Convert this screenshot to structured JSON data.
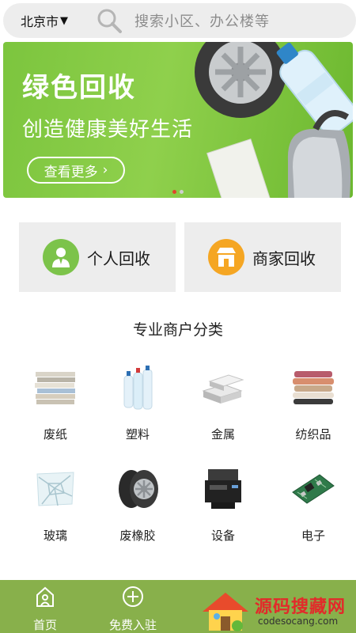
{
  "header": {
    "city": "北京市",
    "city_caret": "▼",
    "search_placeholder": "搜索小区、办公楼等"
  },
  "banner": {
    "title": "绿色回收",
    "subtitle": "创造健康美好生活",
    "button_label": "查看更多",
    "button_arrow": "›",
    "slide_count": 2,
    "active_slide": 1
  },
  "entries": [
    {
      "label": "个人回收",
      "icon": "person-icon",
      "color": "#7cc34a"
    },
    {
      "label": "商家回收",
      "icon": "store-icon",
      "color": "#f5a623"
    }
  ],
  "section": {
    "title": "专业商户分类"
  },
  "categories": [
    {
      "label": "废纸",
      "icon": "paper-stack-icon"
    },
    {
      "label": "塑料",
      "icon": "plastic-bottles-icon"
    },
    {
      "label": "金属",
      "icon": "metal-ingots-icon"
    },
    {
      "label": "纺织品",
      "icon": "textiles-icon"
    },
    {
      "label": "玻璃",
      "icon": "broken-glass-icon"
    },
    {
      "label": "废橡胶",
      "icon": "tires-icon"
    },
    {
      "label": "设备",
      "icon": "printer-icon"
    },
    {
      "label": "电子",
      "icon": "circuit-board-icon"
    }
  ],
  "bottom_nav": [
    {
      "label": "首页",
      "icon": "home-icon"
    },
    {
      "label": "免费入驻",
      "icon": "plus-circle-icon"
    }
  ],
  "watermark": {
    "title": "源码搜藏网",
    "url": "codesocang.com"
  },
  "colors": {
    "brand_green": "#88b04b",
    "banner_green": "#8fd04c",
    "panel_gray": "#ededed"
  }
}
